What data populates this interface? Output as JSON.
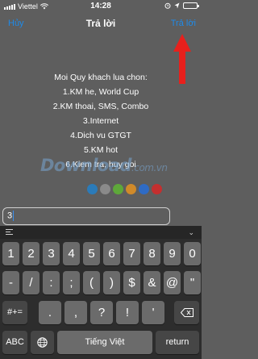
{
  "status_bar": {
    "carrier": "Viettel",
    "time": "14:28"
  },
  "nav": {
    "cancel": "Hủy",
    "title": "Trả lời",
    "reply": "Trả lời"
  },
  "message_lines": [
    "Moi Quy khach lua chon:",
    "1.KM he, World Cup",
    "2.KM thoai, SMS, Combo",
    "3.Internet",
    "4.Dich vu GTGT",
    "5.KM hot",
    "6.Kiem tra, huy goi"
  ],
  "watermark": {
    "text": "Download",
    "tld": ".com.vn",
    "dot_colors": [
      "#2b7bb9",
      "#8a8a8a",
      "#5ea83a",
      "#d08a2a",
      "#2f6bc4",
      "#c42f2f"
    ]
  },
  "input": {
    "value": "3"
  },
  "keyboard": {
    "row1": [
      "1",
      "2",
      "3",
      "4",
      "5",
      "6",
      "7",
      "8",
      "9",
      "0"
    ],
    "row2": [
      "-",
      "/",
      ":",
      ";",
      "(",
      ")",
      "$",
      "&",
      "@",
      "\""
    ],
    "row3_left": "#+=",
    "row3": [
      ".",
      ",",
      "?",
      "!",
      "'"
    ],
    "row4_left": "ABC",
    "space": "Tiếng Việt",
    "return": "return"
  }
}
